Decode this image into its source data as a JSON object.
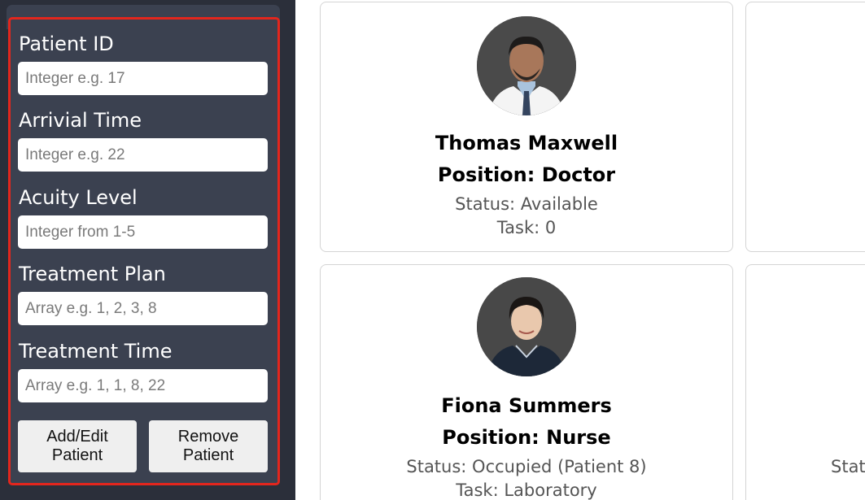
{
  "form": {
    "fields": [
      {
        "label": "Patient ID",
        "placeholder": "Integer e.g. 17"
      },
      {
        "label": "Arrivial Time",
        "placeholder": "Integer e.g. 22"
      },
      {
        "label": "Acuity Level",
        "placeholder": "Integer from 1-5"
      },
      {
        "label": "Treatment Plan",
        "placeholder": "Array e.g. 1, 2, 3, 8"
      },
      {
        "label": "Treatment Time",
        "placeholder": "Array e.g. 1, 1, 8, 22"
      }
    ],
    "add_button": "Add/Edit Patient",
    "remove_button": "Remove Patient"
  },
  "staff": [
    {
      "name": "Thomas Maxwell",
      "position": "Position: Doctor",
      "status": "Status: Available",
      "task": "Task: 0"
    },
    {
      "name": "Fiona Summers",
      "position": "Position: Nurse",
      "status": "Status: Occupied (Patient 8)",
      "task": "Task: Laboratory"
    }
  ],
  "partial_card": {
    "status_fragment": "Statu"
  },
  "colors": {
    "sidebar_bg": "#2b2f3a",
    "panel_bg": "#3b4150",
    "highlight_border": "#e3261d"
  }
}
